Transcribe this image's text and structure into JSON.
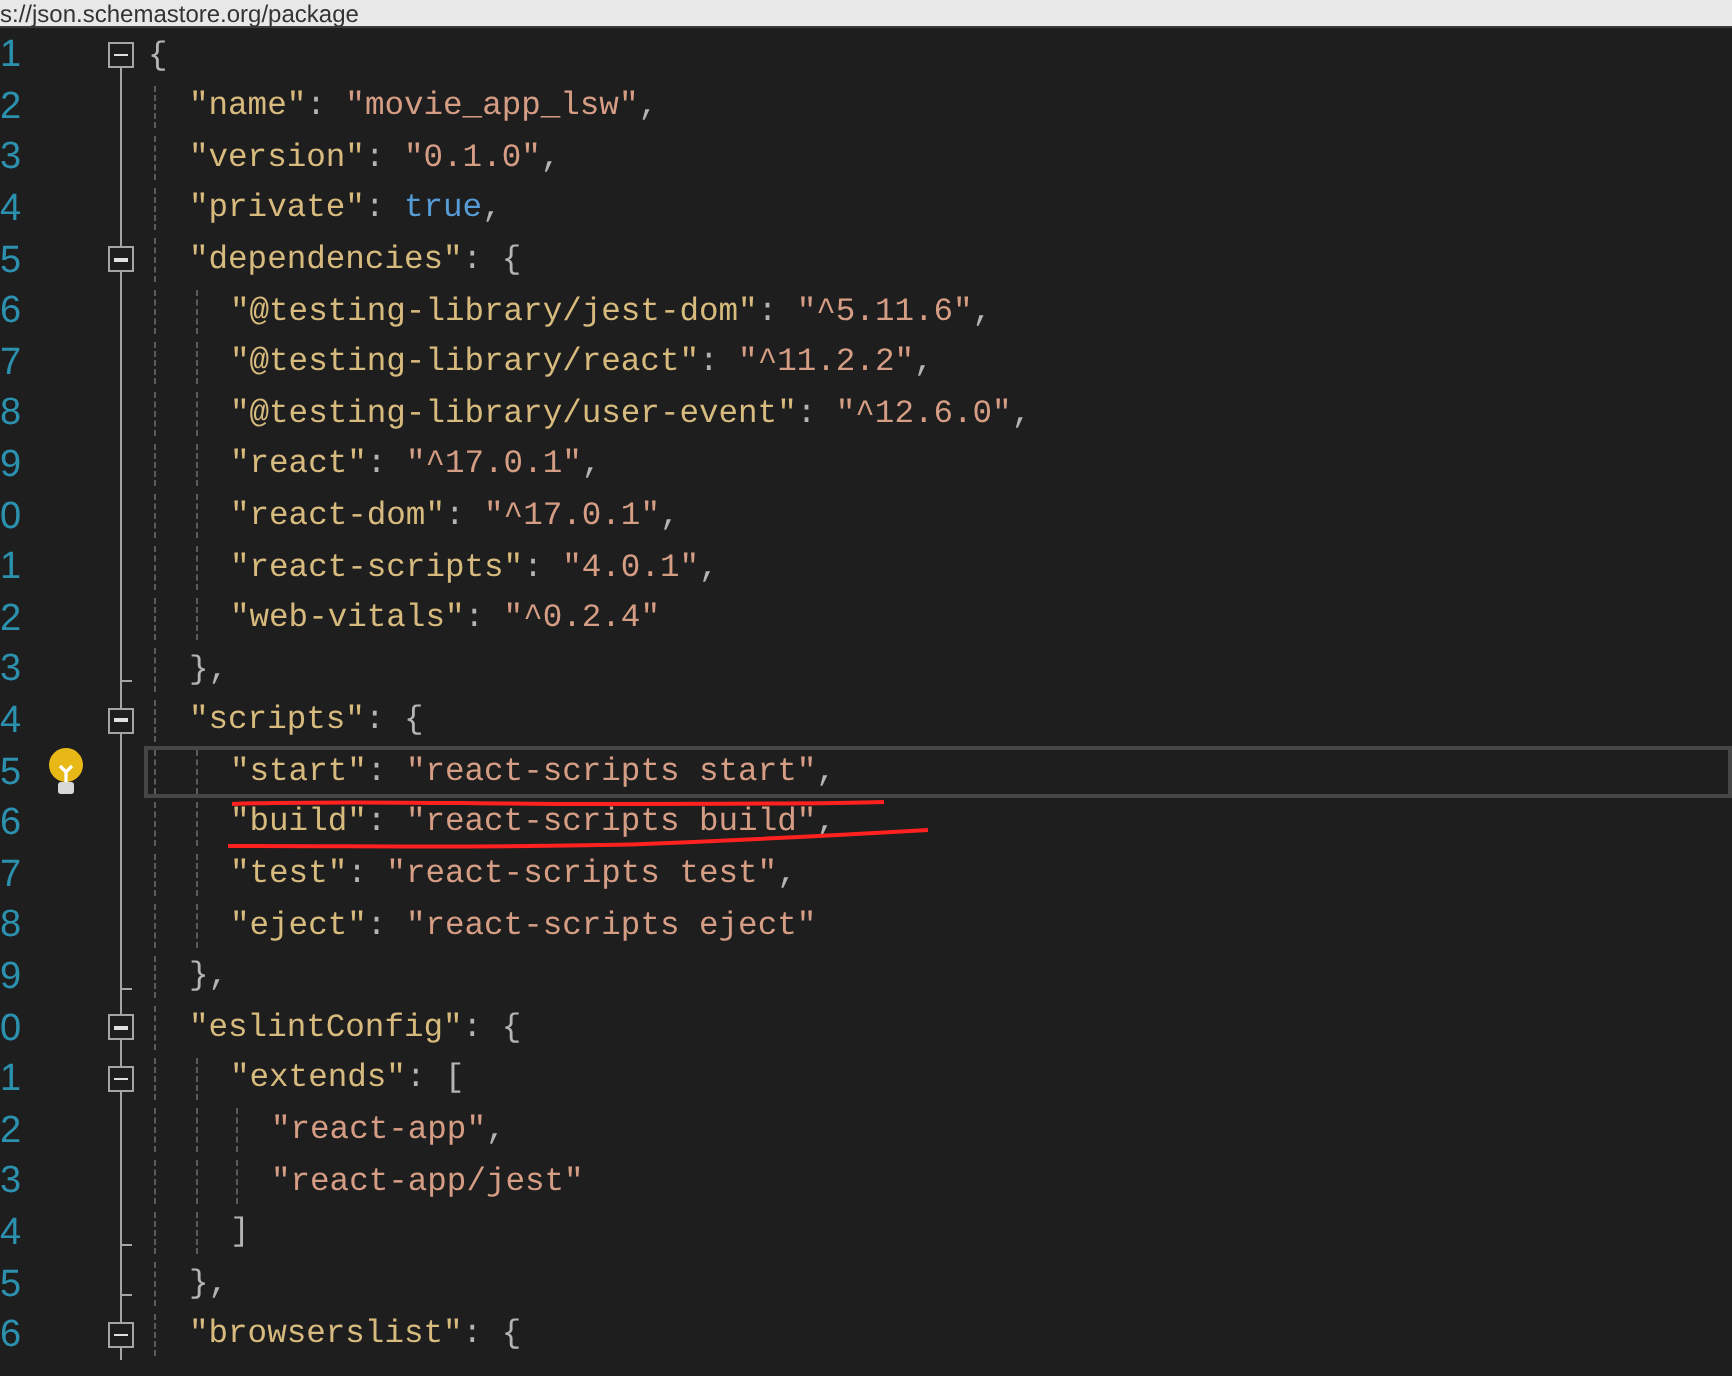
{
  "address_bar": {
    "text": "s://json.schemastore.org/package"
  },
  "lines": [
    {
      "number": "1",
      "current": false,
      "collapsible": true,
      "expanded": true,
      "tokens": [
        {
          "kind": "punct",
          "text": "{"
        }
      ],
      "children": [
        {
          "number": "2",
          "current": false,
          "tokens": [
            {
              "kind": "key",
              "text": "\"name\""
            },
            {
              "kind": "punct",
              "text": ": "
            },
            {
              "kind": "string",
              "text": "\"movie_app_lsw\""
            },
            {
              "kind": "punct",
              "text": ","
            }
          ]
        },
        {
          "number": "3",
          "current": false,
          "tokens": [
            {
              "kind": "key",
              "text": "\"version\""
            },
            {
              "kind": "punct",
              "text": ": "
            },
            {
              "kind": "string",
              "text": "\"0.1.0\""
            },
            {
              "kind": "punct",
              "text": ","
            }
          ]
        },
        {
          "number": "4",
          "current": false,
          "tokens": [
            {
              "kind": "key",
              "text": "\"private\""
            },
            {
              "kind": "punct",
              "text": ": "
            },
            {
              "kind": "keyword",
              "text": "true"
            },
            {
              "kind": "punct",
              "text": ","
            }
          ]
        },
        {
          "number": "5",
          "current": false,
          "collapsible": true,
          "expanded": true,
          "tokens": [
            {
              "kind": "key",
              "text": "\"dependencies\""
            },
            {
              "kind": "punct",
              "text": ": {"
            }
          ],
          "children": [
            {
              "number": "6",
              "current": false,
              "tokens": [
                {
                  "kind": "key",
                  "text": "\"@testing-library/jest-dom\""
                },
                {
                  "kind": "punct",
                  "text": ": "
                },
                {
                  "kind": "string",
                  "text": "\"^5.11.6\""
                },
                {
                  "kind": "punct",
                  "text": ","
                }
              ]
            },
            {
              "number": "7",
              "current": false,
              "tokens": [
                {
                  "kind": "key",
                  "text": "\"@testing-library/react\""
                },
                {
                  "kind": "punct",
                  "text": ": "
                },
                {
                  "kind": "string",
                  "text": "\"^11.2.2\""
                },
                {
                  "kind": "punct",
                  "text": ","
                }
              ]
            },
            {
              "number": "8",
              "current": false,
              "tokens": [
                {
                  "kind": "key",
                  "text": "\"@testing-library/user-event\""
                },
                {
                  "kind": "punct",
                  "text": ": "
                },
                {
                  "kind": "string",
                  "text": "\"^12.6.0\""
                },
                {
                  "kind": "punct",
                  "text": ","
                }
              ]
            },
            {
              "number": "9",
              "current": false,
              "tokens": [
                {
                  "kind": "key",
                  "text": "\"react\""
                },
                {
                  "kind": "punct",
                  "text": ": "
                },
                {
                  "kind": "string",
                  "text": "\"^17.0.1\""
                },
                {
                  "kind": "punct",
                  "text": ","
                }
              ]
            },
            {
              "number": "0",
              "current": false,
              "tokens": [
                {
                  "kind": "key",
                  "text": "\"react-dom\""
                },
                {
                  "kind": "punct",
                  "text": ": "
                },
                {
                  "kind": "string",
                  "text": "\"^17.0.1\""
                },
                {
                  "kind": "punct",
                  "text": ","
                }
              ]
            },
            {
              "number": "1",
              "current": false,
              "tokens": [
                {
                  "kind": "key",
                  "text": "\"react-scripts\""
                },
                {
                  "kind": "punct",
                  "text": ": "
                },
                {
                  "kind": "string",
                  "text": "\"4.0.1\""
                },
                {
                  "kind": "punct",
                  "text": ","
                }
              ]
            },
            {
              "number": "2",
              "current": false,
              "tokens": [
                {
                  "kind": "key",
                  "text": "\"web-vitals\""
                },
                {
                  "kind": "punct",
                  "text": ": "
                },
                {
                  "kind": "string",
                  "text": "\"^0.2.4\""
                }
              ]
            }
          ]
        },
        {
          "number": "3",
          "current": false,
          "tokens": [
            {
              "kind": "punct",
              "text": "},"
            }
          ]
        },
        {
          "number": "4",
          "current": false,
          "collapsible": true,
          "expanded": true,
          "tokens": [
            {
              "kind": "key",
              "text": "\"scripts\""
            },
            {
              "kind": "punct",
              "text": ": {"
            }
          ],
          "children": [
            {
              "number": "5",
              "current": true,
              "tokens": [
                {
                  "kind": "key",
                  "text": "\"start\""
                },
                {
                  "kind": "punct",
                  "text": ": "
                },
                {
                  "kind": "string",
                  "text": "\"react-scripts start\""
                },
                {
                  "kind": "punct",
                  "text": ","
                }
              ]
            },
            {
              "number": "6",
              "current": false,
              "marked": true,
              "tokens": [
                {
                  "kind": "key",
                  "text": "\"build\""
                },
                {
                  "kind": "punct",
                  "text": ": "
                },
                {
                  "kind": "string",
                  "text": "\"react-scripts build\""
                },
                {
                  "kind": "punct",
                  "text": ","
                }
              ]
            },
            {
              "number": "7",
              "current": false,
              "tokens": [
                {
                  "kind": "key",
                  "text": "\"test\""
                },
                {
                  "kind": "punct",
                  "text": ": "
                },
                {
                  "kind": "string",
                  "text": "\"react-scripts test\""
                },
                {
                  "kind": "punct",
                  "text": ","
                }
              ]
            },
            {
              "number": "8",
              "current": false,
              "tokens": [
                {
                  "kind": "key",
                  "text": "\"eject\""
                },
                {
                  "kind": "punct",
                  "text": ": "
                },
                {
                  "kind": "string",
                  "text": "\"react-scripts eject\""
                }
              ]
            }
          ]
        },
        {
          "number": "9",
          "current": false,
          "tokens": [
            {
              "kind": "punct",
              "text": "},"
            }
          ]
        },
        {
          "number": "0",
          "current": false,
          "collapsible": true,
          "expanded": true,
          "tokens": [
            {
              "kind": "key",
              "text": "\"eslintConfig\""
            },
            {
              "kind": "punct",
              "text": ": {"
            }
          ],
          "children": [
            {
              "number": "1",
              "current": false,
              "collapsible": true,
              "expanded": true,
              "tokens": [
                {
                  "kind": "key",
                  "text": "\"extends\""
                },
                {
                  "kind": "punct",
                  "text": ": ["
                }
              ],
              "children": [
                {
                  "number": "2",
                  "current": false,
                  "tokens": [
                    {
                      "kind": "string",
                      "text": "\"react-app\""
                    },
                    {
                      "kind": "punct",
                      "text": ","
                    }
                  ]
                },
                {
                  "number": "3",
                  "current": false,
                  "tokens": [
                    {
                      "kind": "string",
                      "text": "\"react-app/jest\""
                    }
                  ]
                }
              ]
            },
            {
              "number": "4",
              "current": false,
              "tokens": [
                {
                  "kind": "punct",
                  "text": "]"
                }
              ]
            }
          ]
        },
        {
          "number": "5",
          "current": false,
          "tokens": [
            {
              "kind": "punct",
              "text": "},"
            }
          ]
        },
        {
          "number": "6",
          "current": false,
          "collapsible": true,
          "expanded": true,
          "tokens": [
            {
              "kind": "key",
              "text": "\"browserslist\""
            },
            {
              "kind": "punct",
              "text": ": {"
            }
          ]
        }
      ]
    }
  ]
}
